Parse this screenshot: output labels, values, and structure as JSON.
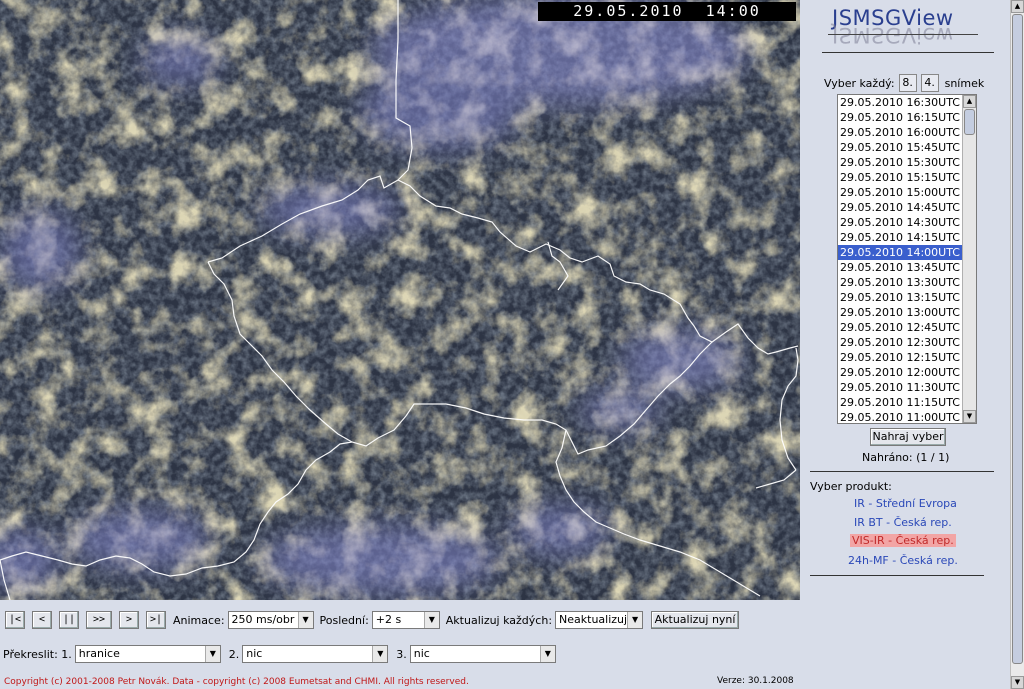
{
  "timestamp": "29.05.2010  14:00",
  "app": {
    "logo": "JSMSGView"
  },
  "selector": {
    "label": "Vyber každý:",
    "field1": "8.",
    "field2": "4.",
    "unit": "snímek",
    "times": [
      "29.05.2010 16:30UTC",
      "29.05.2010 16:15UTC",
      "29.05.2010 16:00UTC",
      "29.05.2010 15:45UTC",
      "29.05.2010 15:30UTC",
      "29.05.2010 15:15UTC",
      "29.05.2010 15:00UTC",
      "29.05.2010 14:45UTC",
      "29.05.2010 14:30UTC",
      "29.05.2010 14:15UTC",
      "29.05.2010 14:00UTC",
      "29.05.2010 13:45UTC",
      "29.05.2010 13:30UTC",
      "29.05.2010 13:15UTC",
      "29.05.2010 13:00UTC",
      "29.05.2010 12:45UTC",
      "29.05.2010 12:30UTC",
      "29.05.2010 12:15UTC",
      "29.05.2010 12:00UTC",
      "29.05.2010 11:30UTC",
      "29.05.2010 11:15UTC",
      "29.05.2010 11:00UTC"
    ],
    "selected_time": "29.05.2010 14:00UTC",
    "load_button": "Nahraj vyber",
    "loaded_text": "Nahráno:  (1 / 1)"
  },
  "products": {
    "label": "Vyber produkt:",
    "items": [
      "IR - Střední Evropa",
      "IR BT - Česká rep.",
      "VIS-IR - Česká rep.",
      "24h-MF - Česká rep."
    ],
    "active": "VIS-IR - Česká rep."
  },
  "controls": {
    "nav": [
      "|<",
      "<",
      "||",
      ">>",
      ">",
      ">|"
    ],
    "animation_label": "Animace:",
    "animation_value": "250 ms/obr",
    "last_label": "Poslední:",
    "last_value": "+2 s",
    "update_label": "Aktualizuj každých:",
    "update_value": "Neaktualizuj",
    "update_now": "Aktualizuj nyní",
    "overlay_label": "Překreslit: 1.",
    "overlay1": "hranice",
    "overlay2_label": "2.",
    "overlay2": "nic",
    "overlay3_label": "3.",
    "overlay3": "nic"
  },
  "footer": {
    "copyright": "Copyright (c) 2001-2008 Petr Novák. Data - copyright (c) 2008 Eumetsat and CHMI. All rights reserved.",
    "version": "Verze: 30.1.2008"
  }
}
